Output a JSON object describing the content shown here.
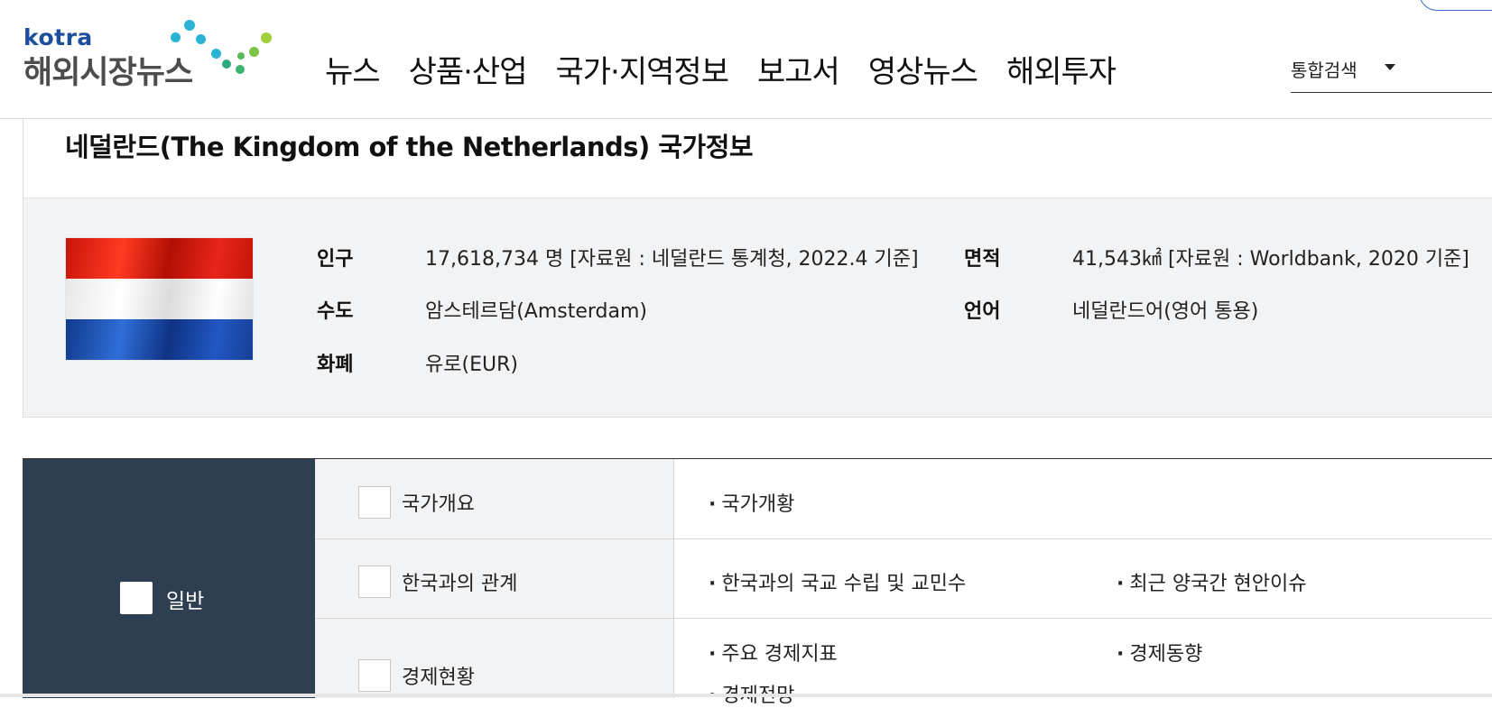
{
  "header": {
    "logo_small": "kotra",
    "logo_title": "해외시장뉴스",
    "nav": [
      "뉴스",
      "상품·산업",
      "국가·지역정보",
      "보고서",
      "영상뉴스",
      "해외투자"
    ],
    "search_select": "통합검색"
  },
  "page": {
    "title": "네덜란드(The Kingdom of the Netherlands) 국가정보"
  },
  "info": {
    "population_label": "인구",
    "population_value": "17,618,734 명 [자료원 : 네덜란드 통계청, 2022.4 기준]",
    "area_label": "면적",
    "area_value": "41,543㎢ [자료원 : Worldbank, 2020 기준]",
    "capital_label": "수도",
    "capital_value": "암스테르담(Amsterdam)",
    "language_label": "언어",
    "language_value": "네덜란드어(영어 통용)",
    "currency_label": "화폐",
    "currency_value": "유로(EUR)"
  },
  "table": {
    "category": "일반",
    "rows": [
      {
        "label": "국가개요",
        "links": [
          "국가개황"
        ]
      },
      {
        "label": "한국과의 관계",
        "links": [
          "한국과의 국교 수립 및 교민수",
          "최근 양국간 현안이슈"
        ]
      },
      {
        "label": "경제현황",
        "links": [
          "주요 경제지표",
          "경제동향",
          "경제전망"
        ]
      }
    ]
  },
  "colors": {
    "brand_blue": "#1d4f9c",
    "category_bg": "#2f3f52",
    "info_bg": "#f2f3f5"
  }
}
